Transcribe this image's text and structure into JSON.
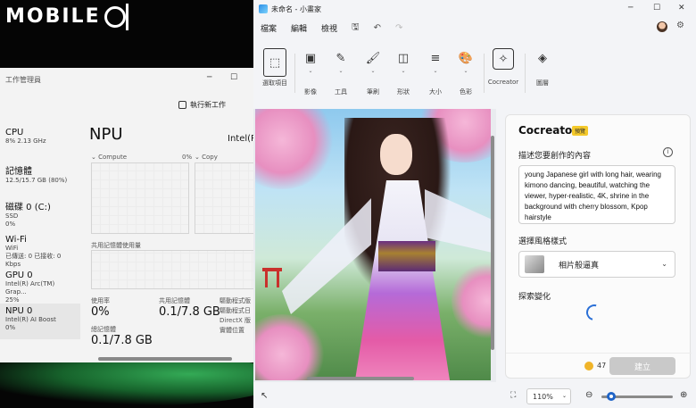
{
  "brand": {
    "logo_text": "MOBILE"
  },
  "task_manager": {
    "title": "工作管理員",
    "run_new_task": "執行新工作",
    "side": [
      {
        "name": "CPU",
        "line1": "8%  2.13 GHz",
        "line2": ""
      },
      {
        "name": "記憶體",
        "line1": "12.5/15.7 GB (80%)",
        "line2": ""
      },
      {
        "name": "磁碟 0 (C:)",
        "line1": "SSD",
        "line2": "0%"
      },
      {
        "name": "Wi-Fi",
        "line1": "WiFi",
        "line2": "已傳送: 0 已接收: 0 Kbps"
      },
      {
        "name": "GPU 0",
        "line1": "Intel(R) Arc(TM) Grap...",
        "line2": "25%"
      },
      {
        "name": "NPU 0",
        "line1": "Intel(R) AI Boost",
        "line2": "0%"
      }
    ],
    "main": {
      "title": "NPU",
      "subtitle": "Intel(R",
      "compute_label": "Compute",
      "compute_pct": "0%",
      "copy_label": "Copy",
      "shared_mem_label": "共用記憶體使用量",
      "usage_label": "使用率",
      "usage_value": "0%",
      "shared_label": "共用記憶體",
      "shared_value": "0.1/7.8 GB",
      "driver_label1": "驅動程式版",
      "driver_label2": "驅動程式日",
      "directx_label": "DirectX 版",
      "location_label": "實體位置",
      "npu_mem_label": "總記憶體",
      "npu_mem_value": "0.1/7.8 GB"
    }
  },
  "paint": {
    "title": "未命名 - 小畫家",
    "menu": [
      "檔案",
      "編輯",
      "檢視"
    ],
    "ribbon": [
      {
        "label": "選取項目",
        "icon": "selection-icon"
      },
      {
        "label": "影像",
        "icon": "image-icon"
      },
      {
        "label": "工具",
        "icon": "tools-icon"
      },
      {
        "label": "筆刷",
        "icon": "brush-icon"
      },
      {
        "label": "形狀",
        "icon": "shapes-icon"
      },
      {
        "label": "大小",
        "icon": "size-icon"
      },
      {
        "label": "色彩",
        "icon": "palette-icon"
      },
      {
        "label": "Cocreator",
        "icon": "cocreator-icon"
      },
      {
        "label": "圖層",
        "icon": "layers-icon"
      }
    ],
    "panel": {
      "title": "Cocreator",
      "badge": "預覽",
      "describe_label": "描述您要創作的內容",
      "prompt_text": "young Japanese girl with long hair, wearing kimono dancing, beautiful, watching the viewer, hyper-realistic, 4K, shrine in the background with cherry blossom, Kpop hairstyle",
      "style_label": "選擇風格樣式",
      "style_value": "相片般逼真",
      "explore_label": "探索變化",
      "credits": "47",
      "create_button": "建立"
    },
    "status": {
      "zoom": "110%"
    }
  }
}
